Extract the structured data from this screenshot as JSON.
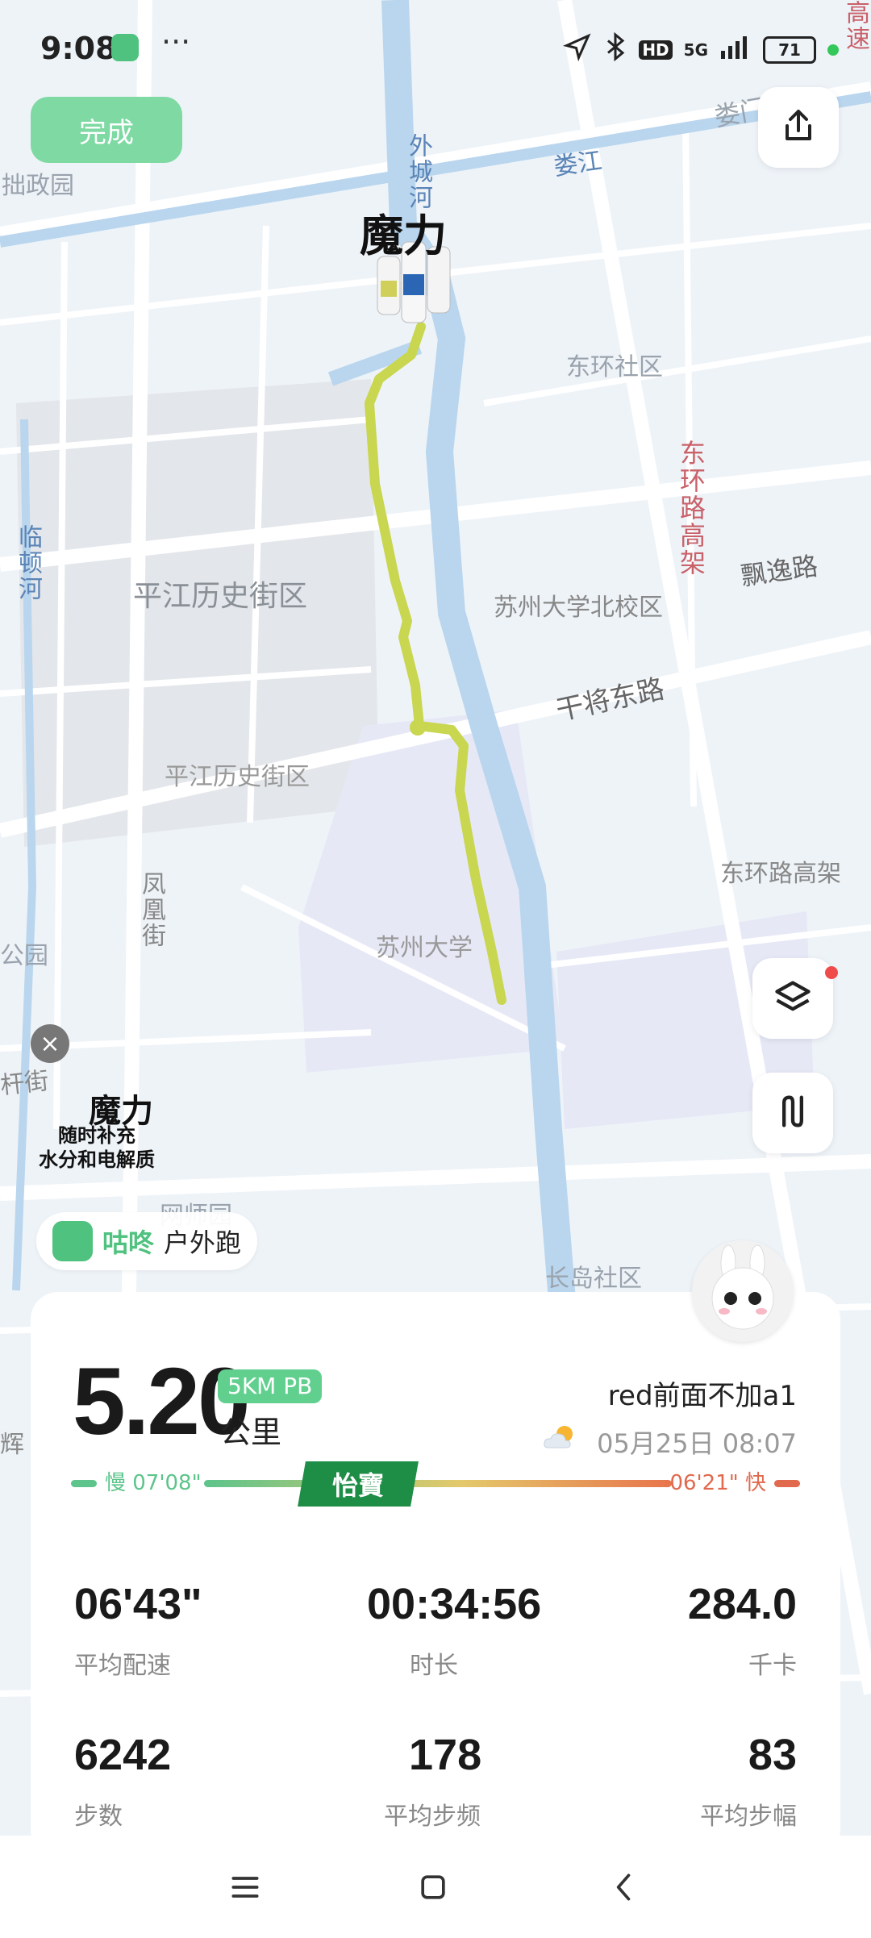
{
  "status_bar": {
    "time": "9:08",
    "more": "···",
    "network": "5G",
    "hd": "HD",
    "battery": "71"
  },
  "top": {
    "done_label": "完成"
  },
  "map": {
    "labels": {
      "zhuozheng": "拙政园",
      "loumen": "娄门路",
      "loujiang": "娄江",
      "waicheng": "外城河",
      "gaosu": "高速",
      "donghuan_shequ": "东环社区",
      "donghuan_gaojia": "东环路高架",
      "piaoyi": "飘逸路",
      "lindun": "临顿河",
      "pingjiang1": "平江历史街区",
      "suzhou_north": "苏州大学北校区",
      "ganjiang": "干将东路",
      "pingjiang2": "平江历史街区",
      "donghuan_gaojia2": "东环路高架",
      "suzhou_uni": "苏州大学",
      "gongyuan": "公园",
      "fenghuang": "凤凰街",
      "jie": "杆街",
      "wangshi": "网师园",
      "changdao": "长岛社区",
      "hui": "辉"
    },
    "route_marker_brand": "魔力"
  },
  "ad": {
    "brand": "魔力",
    "line1": "随时补充",
    "line2": "水分和电解质"
  },
  "badge": {
    "brand": "咕咚",
    "type": "户外跑"
  },
  "summary": {
    "distance": "5.20",
    "pb_label": "5KM PB",
    "unit": "公里",
    "run_name": "red前面不加a1",
    "datetime": "05月25日 08:07",
    "pace_slow": "慢 07'08\"",
    "pace_fast": "06'21\" 快",
    "pace_brand": "怡寶"
  },
  "stats": [
    {
      "value": "06'43\"",
      "label": "平均配速"
    },
    {
      "value": "00:34:56",
      "label": "时长"
    },
    {
      "value": "284.0",
      "label": "千卡"
    },
    {
      "value": "6242",
      "label": "步数"
    },
    {
      "value": "178",
      "label": "平均步频"
    },
    {
      "value": "83",
      "label": "平均步幅"
    }
  ],
  "colors": {
    "route": "#c9d64f",
    "water": "#b9d6ee",
    "accent_green": "#4ec27e",
    "pace_fast": "#e0694e"
  }
}
